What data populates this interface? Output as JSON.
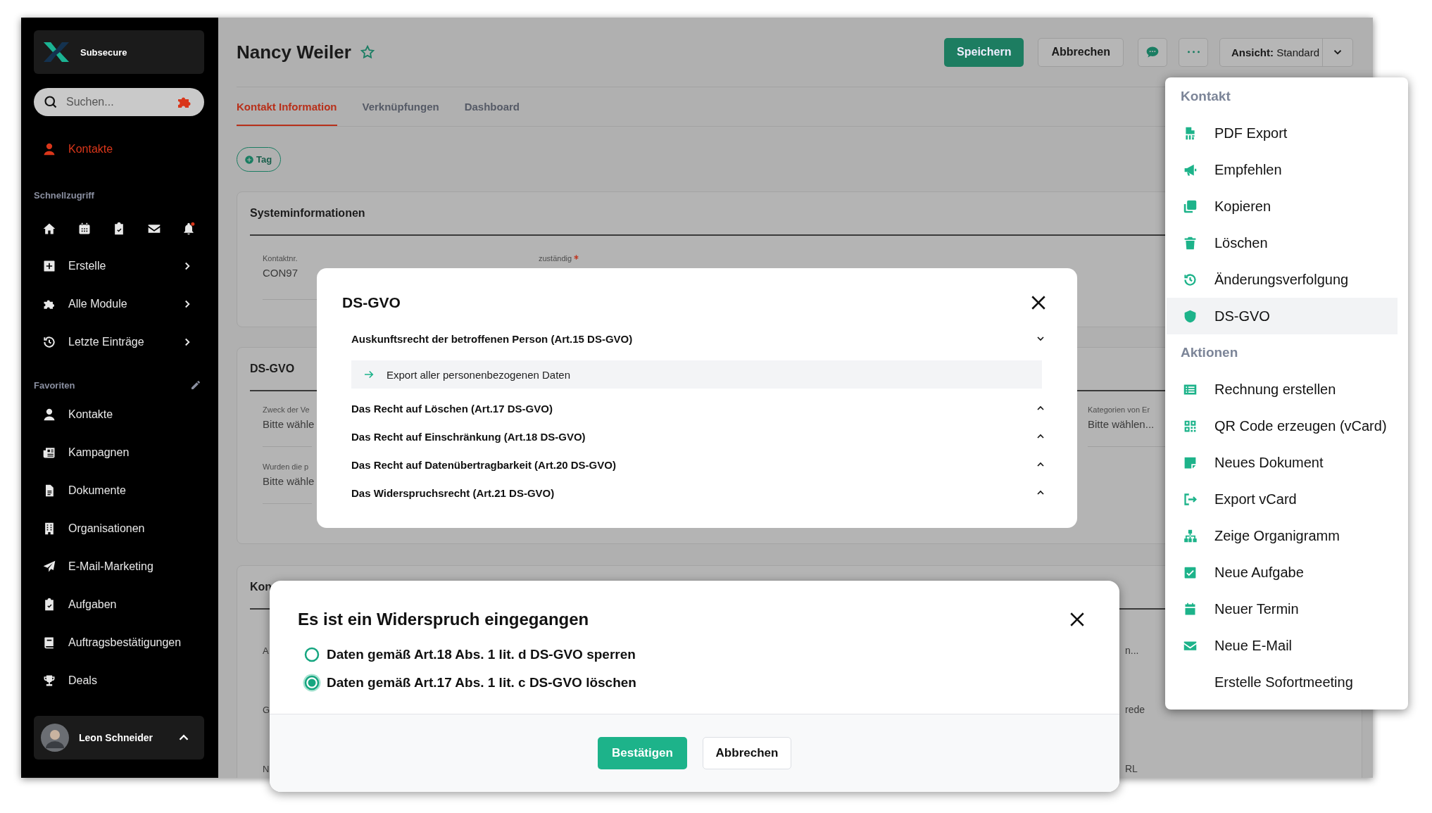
{
  "sidebar": {
    "brand": "Subsecure",
    "search": {
      "placeholder": "Suchen..."
    },
    "nav": [
      {
        "label": "Kontakte",
        "selected": true
      }
    ],
    "quick_access": {
      "title": "Schnellzugriff"
    },
    "menus": [
      {
        "label": "Erstelle"
      },
      {
        "label": "Alle Module"
      },
      {
        "label": "Letzte Einträge"
      }
    ],
    "favorites": {
      "title": "Favoriten",
      "items": [
        {
          "label": "Kontakte"
        },
        {
          "label": "Kampagnen"
        },
        {
          "label": "Dokumente"
        },
        {
          "label": "Organisationen"
        },
        {
          "label": "E-Mail-Marketing"
        },
        {
          "label": "Aufgaben"
        },
        {
          "label": "Auftragsbestätigungen"
        },
        {
          "label": "Deals"
        }
      ]
    },
    "user": {
      "name": "Leon Schneider"
    }
  },
  "header": {
    "title": "Nancy Weiler",
    "starred": false,
    "buttons": [
      {
        "label": "Speichern",
        "kind": "primary"
      },
      {
        "label": "Abbrechen",
        "kind": "secondary"
      }
    ],
    "view_select": {
      "label": "Ansicht:",
      "value": "Standard"
    }
  },
  "tabs": [
    {
      "label": "Kontakt Information",
      "selected": true
    },
    {
      "label": "Verknüpfungen",
      "selected": false
    },
    {
      "label": "Dashboard",
      "selected": false
    }
  ],
  "tag_button": {
    "label": "Tag"
  },
  "sections": [
    {
      "title": "Systeminformationen",
      "fields": [
        {
          "label": "Kontaktnr.",
          "value": "CON97"
        },
        {
          "label": "zuständig",
          "required": true
        }
      ]
    },
    {
      "title": "DS-GVO",
      "fields": [
        {
          "label": "Zweck der Ve",
          "value": "Bitte wähle"
        },
        {
          "label": "Wurden die p",
          "value": "Bitte wähle"
        }
      ],
      "side_fields": [
        {
          "label": "Kategorien von Er",
          "value": "Bitte wählen..."
        }
      ]
    },
    {
      "title": "Kon",
      "rows": [
        {
          "column_1": "A",
          "column_2": "n..."
        },
        {
          "column_1": "G",
          "column_2": "rede"
        },
        {
          "column_1": "N",
          "column_2": "RL"
        }
      ]
    }
  ],
  "dsgvo_dialog": {
    "title": "DS-GVO",
    "sections": [
      {
        "title": "Auskunftsrecht der betroffenen Person (Art.15 DS-GVO)",
        "expanded": true,
        "actions": [
          {
            "label": "Export aller personenbezogenen Daten"
          }
        ]
      },
      {
        "title": "Das Recht auf Löschen (Art.17 DS-GVO)",
        "expanded": false
      },
      {
        "title": "Das Recht auf Einschränkung (Art.18 DS-GVO)",
        "expanded": false
      },
      {
        "title": "Das Recht auf Datenübertragbarkeit (Art.20 DS-GVO)",
        "expanded": false
      },
      {
        "title": "Das Widerspruchsrecht (Art.21 DS-GVO)",
        "expanded": false
      }
    ]
  },
  "objection_dialog": {
    "title": "Es ist ein Widerspruch eingegangen",
    "options": [
      {
        "label": "Daten gemäß Art.18 Abs. 1 lit. d DS-GVO sperren",
        "selected": false
      },
      {
        "label": "Daten gemäß Art.17 Abs. 1 lit. c DS-GVO löschen",
        "selected": true
      }
    ],
    "buttons": [
      {
        "label": "Bestätigen",
        "kind": "primary"
      },
      {
        "label": "Abbrechen",
        "kind": "secondary"
      }
    ]
  },
  "actions_menu": {
    "sections": [
      {
        "title": "Kontakt",
        "items": [
          {
            "label": "PDF Export",
            "selected": false
          },
          {
            "label": "Empfehlen",
            "selected": false
          },
          {
            "label": "Kopieren",
            "selected": false
          },
          {
            "label": "Löschen",
            "selected": false
          },
          {
            "label": "Änderungsverfolgung",
            "selected": false
          },
          {
            "label": "DS-GVO",
            "selected": true
          }
        ]
      },
      {
        "title": "Aktionen",
        "items": [
          {
            "label": "Rechnung erstellen",
            "selected": false
          },
          {
            "label": "QR Code erzeugen (vCard)",
            "selected": false
          },
          {
            "label": "Neues Dokument",
            "selected": false
          },
          {
            "label": "Export vCard",
            "selected": false
          },
          {
            "label": "Zeige Organigramm",
            "selected": false
          },
          {
            "label": "Neue Aufgabe",
            "selected": false
          },
          {
            "label": "Neuer Termin",
            "selected": false
          },
          {
            "label": "Neue E-Mail",
            "selected": false
          },
          {
            "label": "Erstelle Sofortmeeting",
            "selected": false
          }
        ]
      }
    ]
  }
}
